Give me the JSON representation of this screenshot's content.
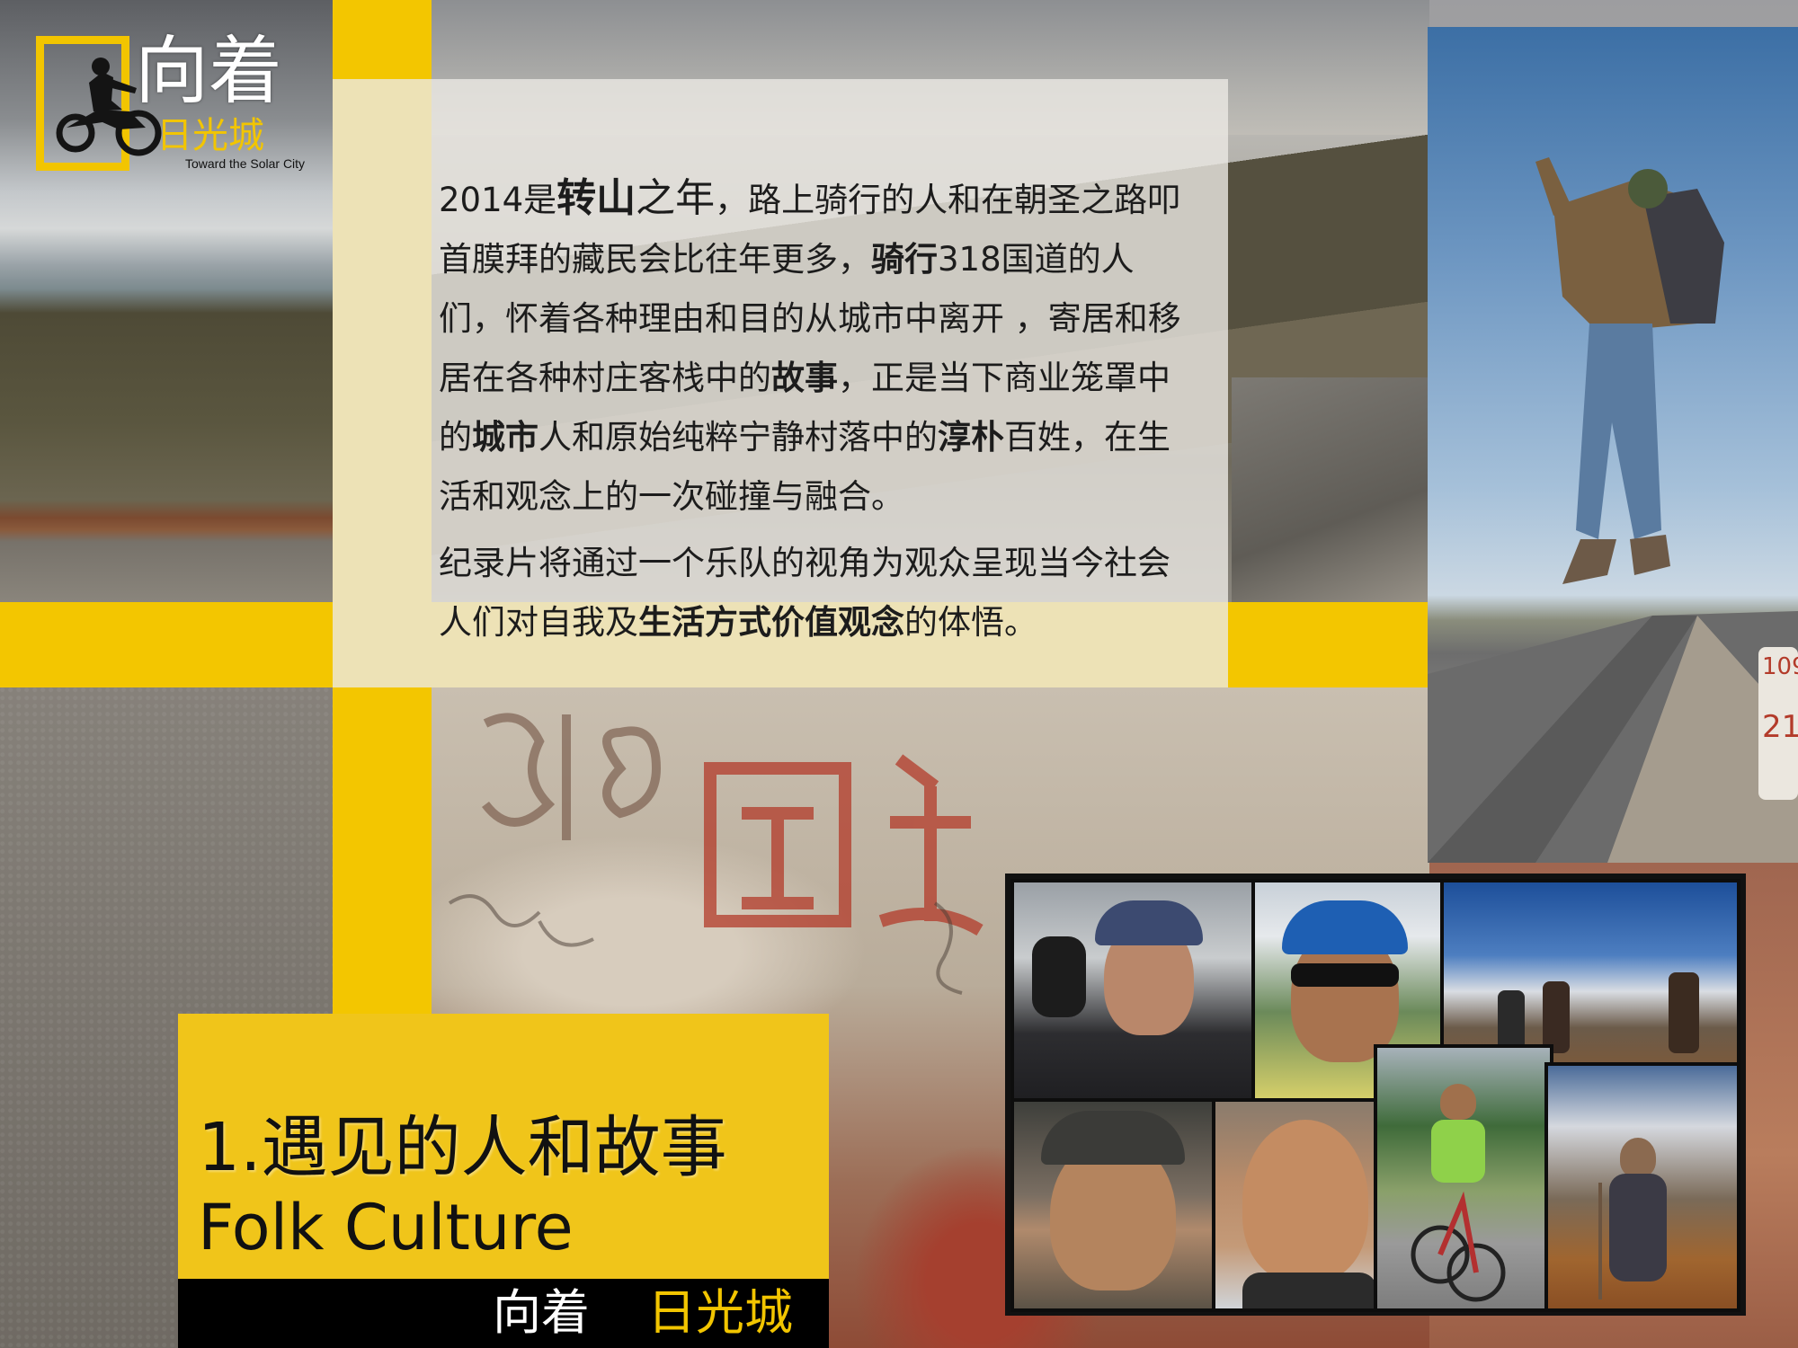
{
  "logo": {
    "title": "向着",
    "subtitle": "日光城",
    "english": "Toward the Solar City"
  },
  "intro": {
    "paragraph1": {
      "t1": "2014是",
      "b1": "转山",
      "big1": "之年",
      "t2": "，路上骑行的人和在朝圣之路叩首膜拜的藏民会比往年更多，",
      "b2": "骑行",
      "t3": "318国道的人们，怀着各种理由和目的从城市中离开 ，寄居和移居在各种村庄客栈中的",
      "b3": "故事",
      "t4": "，正是当下商业笼罩中的",
      "b4": "城市",
      "t5": "人和原始纯粹宁静村落中的",
      "b5": "淳朴",
      "t6": "百姓，在生活和观念上的一次碰撞与融合。"
    },
    "paragraph2": {
      "t1": "纪录片将通过一个乐队的视角为观众呈现当今社会 人们对自我及",
      "b1": "生活方式价值观念",
      "t2": "的体悟。"
    }
  },
  "section": {
    "title_cn": "1.遇见的人和故事",
    "title_en": "Folk Culture"
  },
  "footer": {
    "label_white": "向着",
    "label_yellow": "日光城"
  },
  "colors": {
    "accent_yellow": "#f3c600",
    "title_box_yellow": "#f0c51a",
    "footer_black": "#000000"
  }
}
